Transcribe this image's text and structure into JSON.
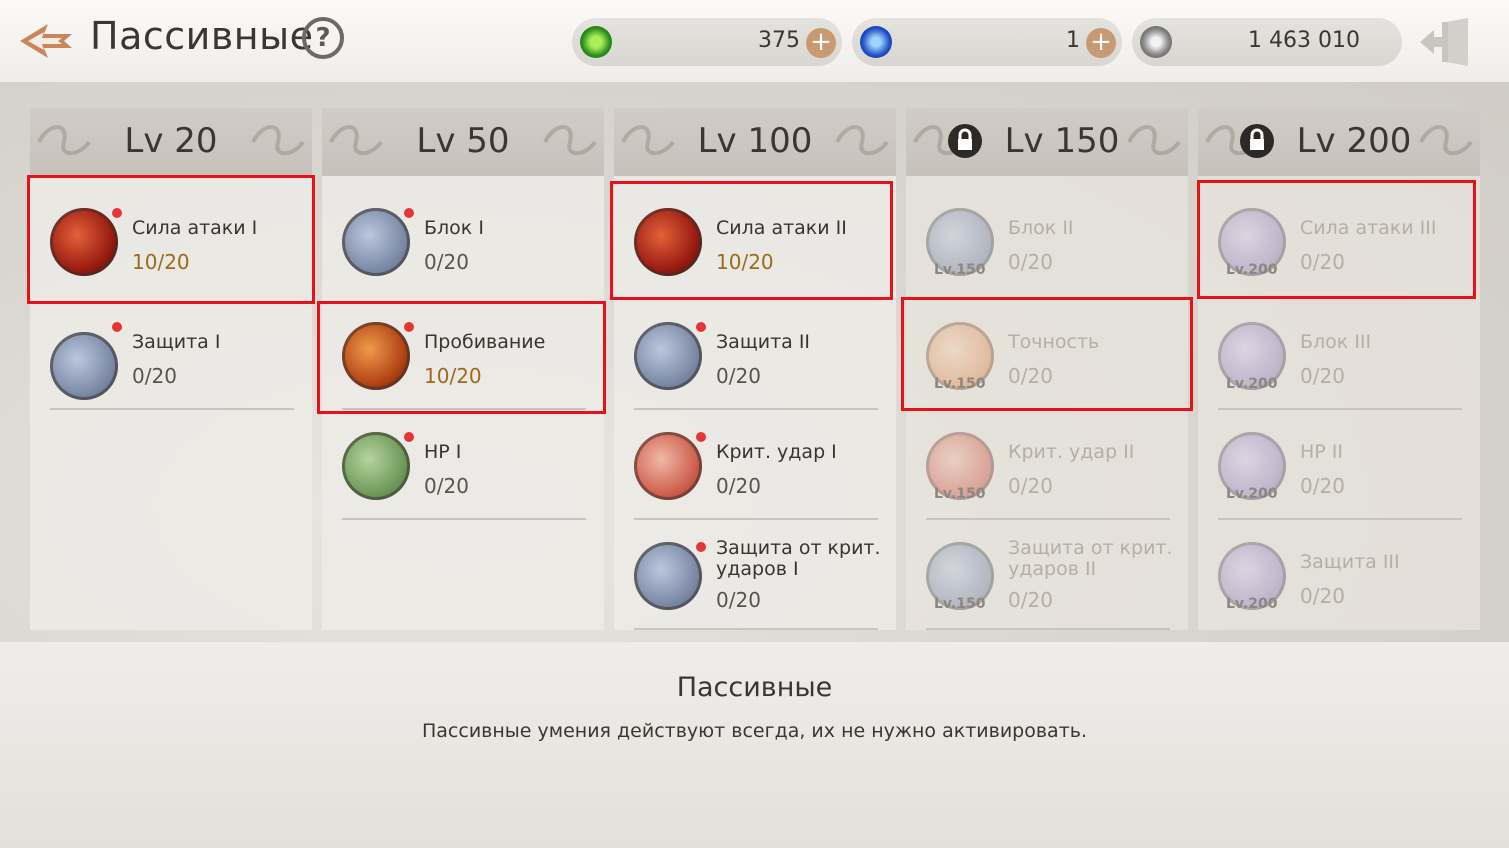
{
  "header": {
    "title": "Пассивные",
    "help": "?",
    "currencies": [
      {
        "icon": "green-swirl-currency-icon",
        "value": "375"
      },
      {
        "icon": "blue-flame-currency-icon",
        "value": "1"
      },
      {
        "icon": "silver-coin-icon",
        "value": "1 463 010"
      }
    ],
    "plus": "+"
  },
  "columns": [
    {
      "level": "Lv 20",
      "locked": false,
      "skills": [
        {
          "name": "Сила атаки I",
          "progress": "10/20",
          "icon": "sword-icon"
        },
        {
          "name": "Защита I",
          "progress": "0/20",
          "icon": "shield-lock-icon"
        }
      ]
    },
    {
      "level": "Lv 50",
      "locked": false,
      "skills": [
        {
          "name": "Блок I",
          "progress": "0/20",
          "icon": "shield-lock-icon"
        },
        {
          "name": "Пробивание",
          "progress": "10/20",
          "icon": "pierce-icon"
        },
        {
          "name": "HP I",
          "progress": "0/20",
          "icon": "leaf-lock-icon"
        }
      ]
    },
    {
      "level": "Lv 100",
      "locked": false,
      "skills": [
        {
          "name": "Сила атаки II",
          "progress": "10/20",
          "icon": "sword-icon"
        },
        {
          "name": "Защита II",
          "progress": "0/20",
          "icon": "shield-lock-icon"
        },
        {
          "name": "Крит. удар I",
          "progress": "0/20",
          "icon": "crit-lock-icon"
        },
        {
          "name": "Защита от крит. ударов I",
          "progress": "0/20",
          "icon": "shield-lock-icon"
        }
      ]
    },
    {
      "level": "Lv 150",
      "locked": true,
      "skills": [
        {
          "name": "Блок II",
          "progress": "0/20",
          "tag": "Lv.150"
        },
        {
          "name": "Точность",
          "progress": "0/20",
          "tag": "Lv.150"
        },
        {
          "name": "Крит. удар II",
          "progress": "0/20",
          "tag": "Lv.150"
        },
        {
          "name": "Защита от крит. ударов II",
          "progress": "0/20",
          "tag": "Lv.150"
        }
      ]
    },
    {
      "level": "Lv 200",
      "locked": true,
      "skills": [
        {
          "name": "Сила атаки III",
          "progress": "0/20",
          "tag": "Lv.200"
        },
        {
          "name": "Блок III",
          "progress": "0/20",
          "tag": "Lv.200"
        },
        {
          "name": "HP II",
          "progress": "0/20",
          "tag": "Lv.200"
        },
        {
          "name": "Защита III",
          "progress": "0/20",
          "tag": "Lv.200"
        }
      ]
    }
  ],
  "description": {
    "title": "Пассивные",
    "text": "Пассивные умения действуют всегда, их не нужно активировать."
  },
  "colors": {
    "highlight": "#e5121b",
    "new_dot": "#e53535",
    "active_progress": "#9b6a1d"
  }
}
